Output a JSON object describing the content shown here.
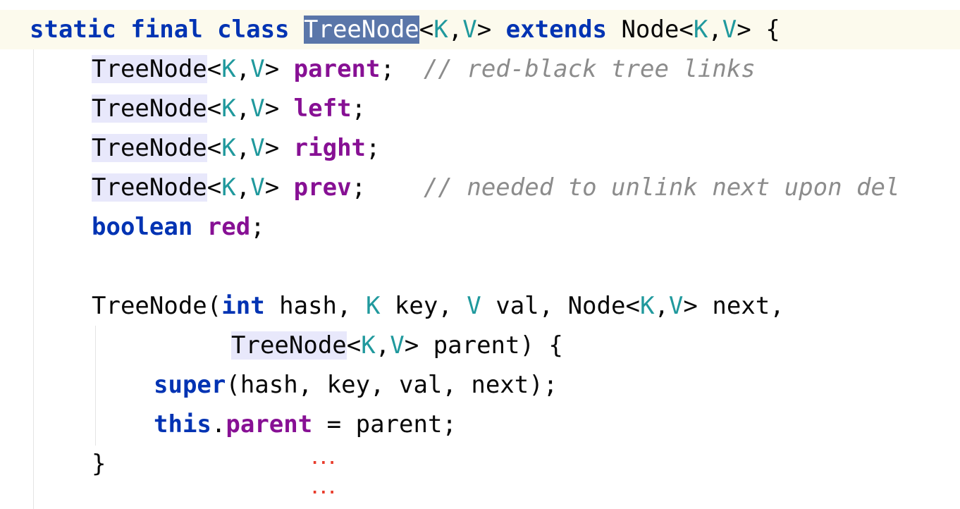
{
  "editor": {
    "line1": {
      "kw_static": "static",
      "kw_final": "final",
      "kw_class": "class",
      "class_name": "TreeNode",
      "lt": "<",
      "tK": "K",
      "comma": ",",
      "tV": "V",
      "gt": ">",
      "kw_extends": "extends",
      "super_type": "Node",
      "lt2": "<",
      "tK2": "K",
      "comma2": ",",
      "tV2": "V",
      "gt2": ">",
      "brace": "{"
    },
    "fields": [
      {
        "type": "TreeNode",
        "name": "parent",
        "semi": ";",
        "comment": "// red-black tree links"
      },
      {
        "type": "TreeNode",
        "name": "left",
        "semi": ";",
        "comment": ""
      },
      {
        "type": "TreeNode",
        "name": "right",
        "semi": ";",
        "comment": ""
      },
      {
        "type": "TreeNode",
        "name": "prev",
        "semi": ";",
        "comment": "// needed to unlink next upon del"
      }
    ],
    "red_field": {
      "kw_boolean": "boolean",
      "name": "red",
      "semi": ";"
    },
    "ctor": {
      "name": "TreeNode",
      "open_paren": "(",
      "kw_int": "int",
      "p1": " hash, ",
      "tK": "K",
      "p2": " key, ",
      "tV": "V",
      "p3": " val, Node",
      "lt": "<",
      "tK2": "K",
      "comma": ",",
      "tV2": "V",
      "gt": ">",
      "p4": " next,",
      "param_type": "TreeNode",
      "lt3": "<",
      "tK3": "K",
      "comma3": ",",
      "tV3": "V",
      "gt3": ">",
      "p5": " parent) {",
      "kw_super": "super",
      "super_args": "(hash, key, val, next);",
      "kw_this": "this",
      "dot": ".",
      "this_field": "parent",
      "assign": " = parent;",
      "close_brace": "}"
    },
    "fold_markers": [
      "...",
      "..."
    ],
    "colors": {
      "keyword": "#0033b3",
      "field": "#871094",
      "type_param": "#20999d",
      "comment": "#8c8c8c",
      "selection": "#5a76a9",
      "usage_highlight": "#e8e8fb",
      "current_line": "#fcfaed",
      "fold_marker": "#e83c2c"
    }
  }
}
